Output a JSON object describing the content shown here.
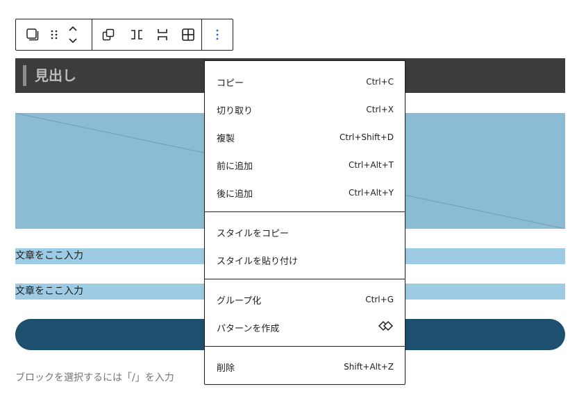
{
  "toolbar": {
    "icons": [
      "transform-icon",
      "drag-handle-icon",
      "move-up-down-icon",
      "group-icon",
      "row-icon",
      "stack-icon",
      "grid-icon",
      "more-options-icon"
    ],
    "accent": "#3858e9"
  },
  "heading_block": {
    "text": "見出し"
  },
  "paragraphs": [
    "文章をここ入力",
    "文章をここ入力"
  ],
  "appender": {
    "placeholder": "ブロックを選択するには「/」を入力"
  },
  "menu": {
    "groups": [
      {
        "items": [
          {
            "label": "コピー",
            "shortcut": "Ctrl+C"
          },
          {
            "label": "切り取り",
            "shortcut": "Ctrl+X"
          },
          {
            "label": "複製",
            "shortcut": "Ctrl+Shift+D"
          },
          {
            "label": "前に追加",
            "shortcut": "Ctrl+Alt+T"
          },
          {
            "label": "後に追加",
            "shortcut": "Ctrl+Alt+Y"
          }
        ]
      },
      {
        "items": [
          {
            "label": "スタイルをコピー"
          },
          {
            "label": "スタイルを貼り付け"
          }
        ]
      },
      {
        "items": [
          {
            "label": "グループ化",
            "shortcut": "Ctrl+G"
          },
          {
            "label": "パターンを作成",
            "icon": "pattern-diamond-icon"
          }
        ]
      },
      {
        "items": [
          {
            "label": "削除",
            "shortcut": "Shift+Alt+Z"
          }
        ]
      }
    ]
  },
  "colors": {
    "heading_bg": "#3c3c3c",
    "image_bg": "#8bbcd4",
    "paragraph_bg": "#9ccbe3",
    "button_bg": "#1d4f6e"
  }
}
